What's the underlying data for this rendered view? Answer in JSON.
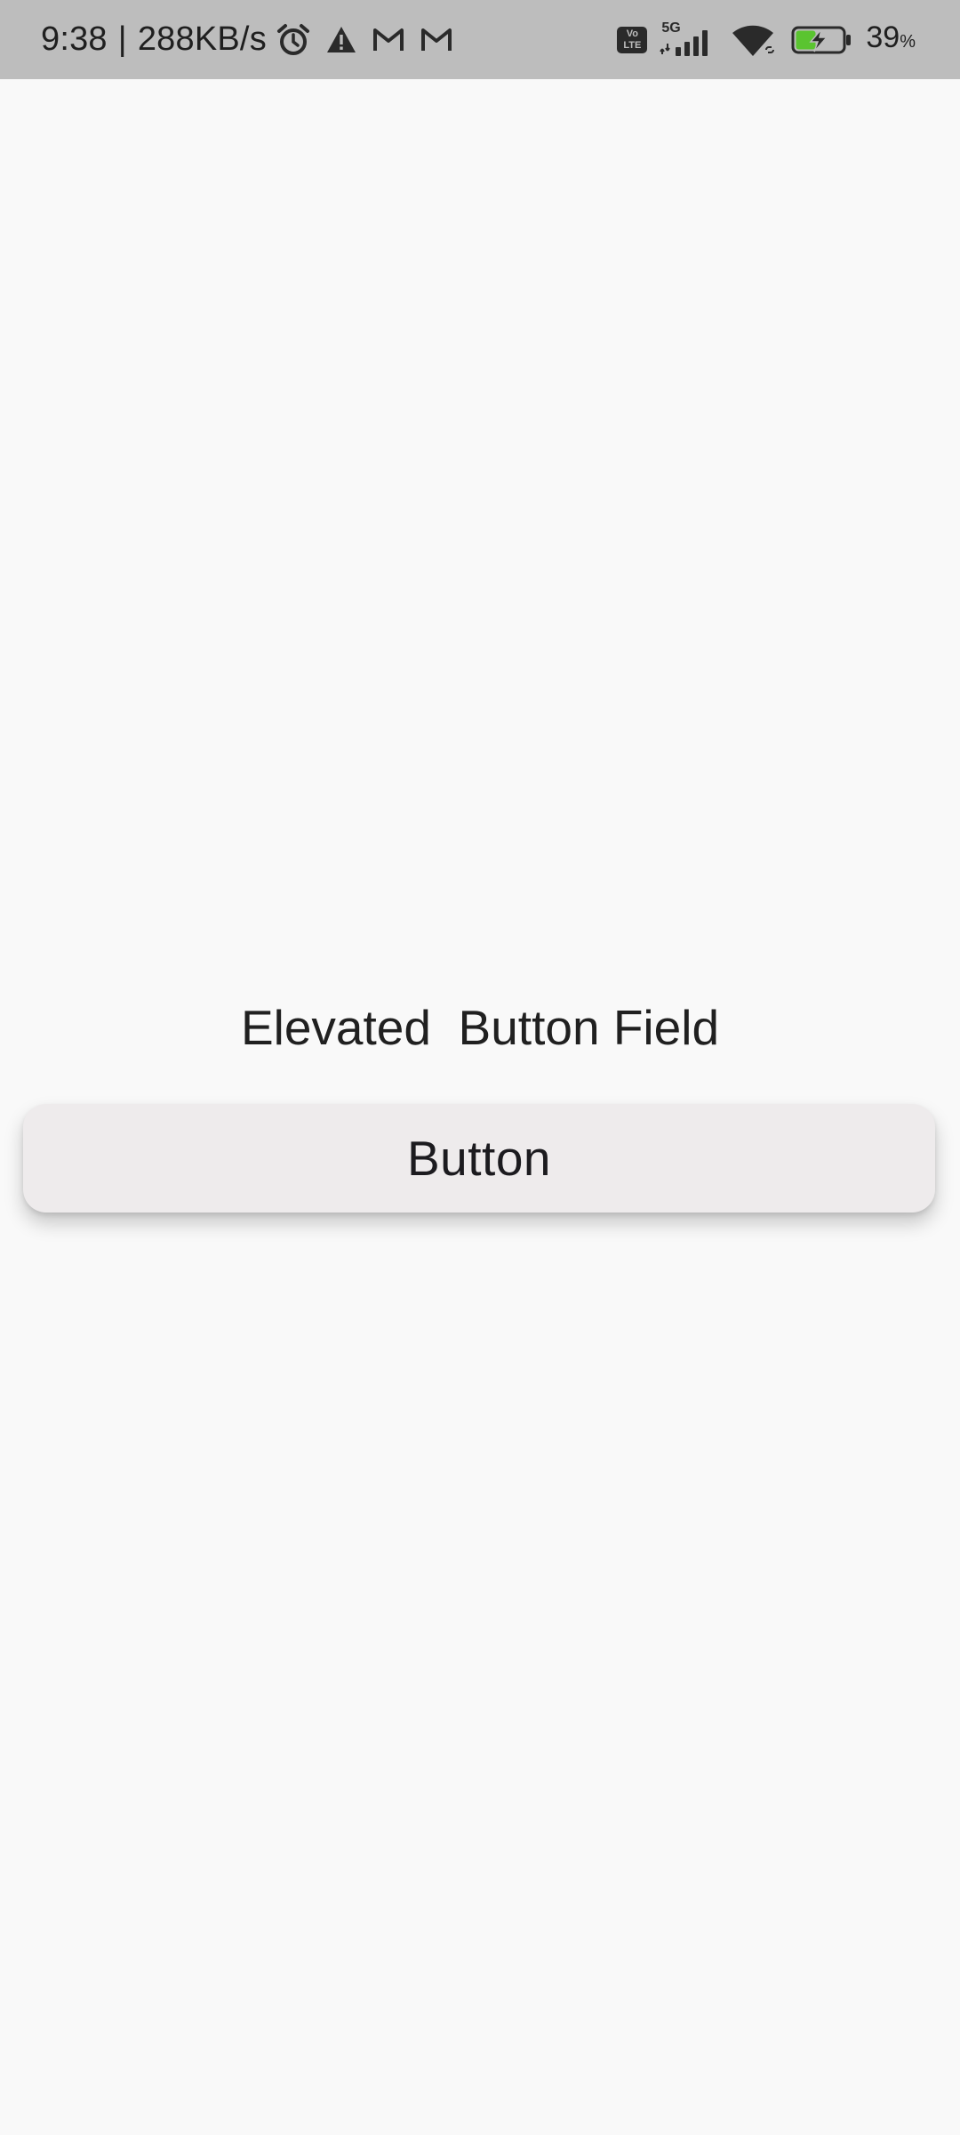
{
  "status_bar": {
    "time": "9:38",
    "separator": "|",
    "net_speed": "288KB/s",
    "left_icons": [
      "alarm-icon",
      "warning-icon",
      "gmail-icon",
      "gmail-icon"
    ],
    "volte_top": "Vo",
    "volte_bottom": "LTE",
    "network_type": "5G",
    "battery_level": "39",
    "battery_unit": "%",
    "battery_color": "#5ac430"
  },
  "main": {
    "heading": "Elevated  Button Field",
    "button_label": "Button"
  },
  "colors": {
    "background": "#f9f9f9",
    "status_bar": "#bdbdbd",
    "button_surface": "#eeebec"
  }
}
